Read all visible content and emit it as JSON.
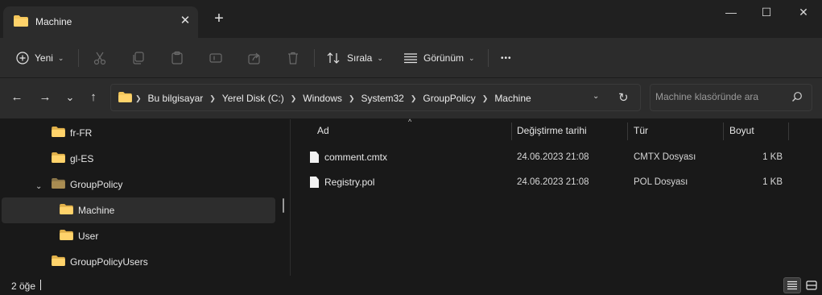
{
  "window": {
    "tab_title": "Machine",
    "close_tab": "✕",
    "new_tab": "+",
    "minimize": "—",
    "maximize": "☐",
    "close": "✕"
  },
  "commandbar": {
    "new_label": "Yeni",
    "sort_label": "Sırala",
    "view_label": "Görünüm",
    "more": "•••",
    "icons": [
      "new-icon",
      "cut-icon",
      "copy-icon",
      "paste-icon",
      "rename-icon",
      "share-icon",
      "delete-icon",
      "sort-icon",
      "view-icon",
      "more-icon"
    ]
  },
  "nav": {
    "back": "←",
    "forward": "→",
    "recent": "⌄",
    "up": "↑",
    "breadcrumbs": [
      "Bu bilgisayar",
      "Yerel Disk (C:)",
      "Windows",
      "System32",
      "GroupPolicy",
      "Machine"
    ],
    "refresh": "↻"
  },
  "search": {
    "placeholder": "Machine klasöründe ara"
  },
  "tree": {
    "items": [
      {
        "label": "fr-FR"
      },
      {
        "label": "gl-ES"
      },
      {
        "label": "GroupPolicy",
        "expanded": true
      },
      {
        "label": "Machine",
        "selected": true
      },
      {
        "label": "User"
      },
      {
        "label": "GroupPolicyUsers"
      }
    ]
  },
  "list": {
    "columns": [
      "Ad",
      "Değiştirme tarihi",
      "Tür",
      "Boyut"
    ],
    "sort_indicator": "^",
    "rows": [
      {
        "name": "comment.cmtx",
        "modified": "24.06.2023 21:08",
        "type": "CMTX Dosyası",
        "size": "1 KB"
      },
      {
        "name": "Registry.pol",
        "modified": "24.06.2023 21:08",
        "type": "POL Dosyası",
        "size": "1 KB"
      }
    ]
  },
  "status": {
    "count": "2 öğe"
  },
  "colors": {
    "folder": "#f4c65a",
    "folder_dark": "#d9a93e",
    "background": "#191919",
    "toolbar": "#2c2c2c"
  }
}
